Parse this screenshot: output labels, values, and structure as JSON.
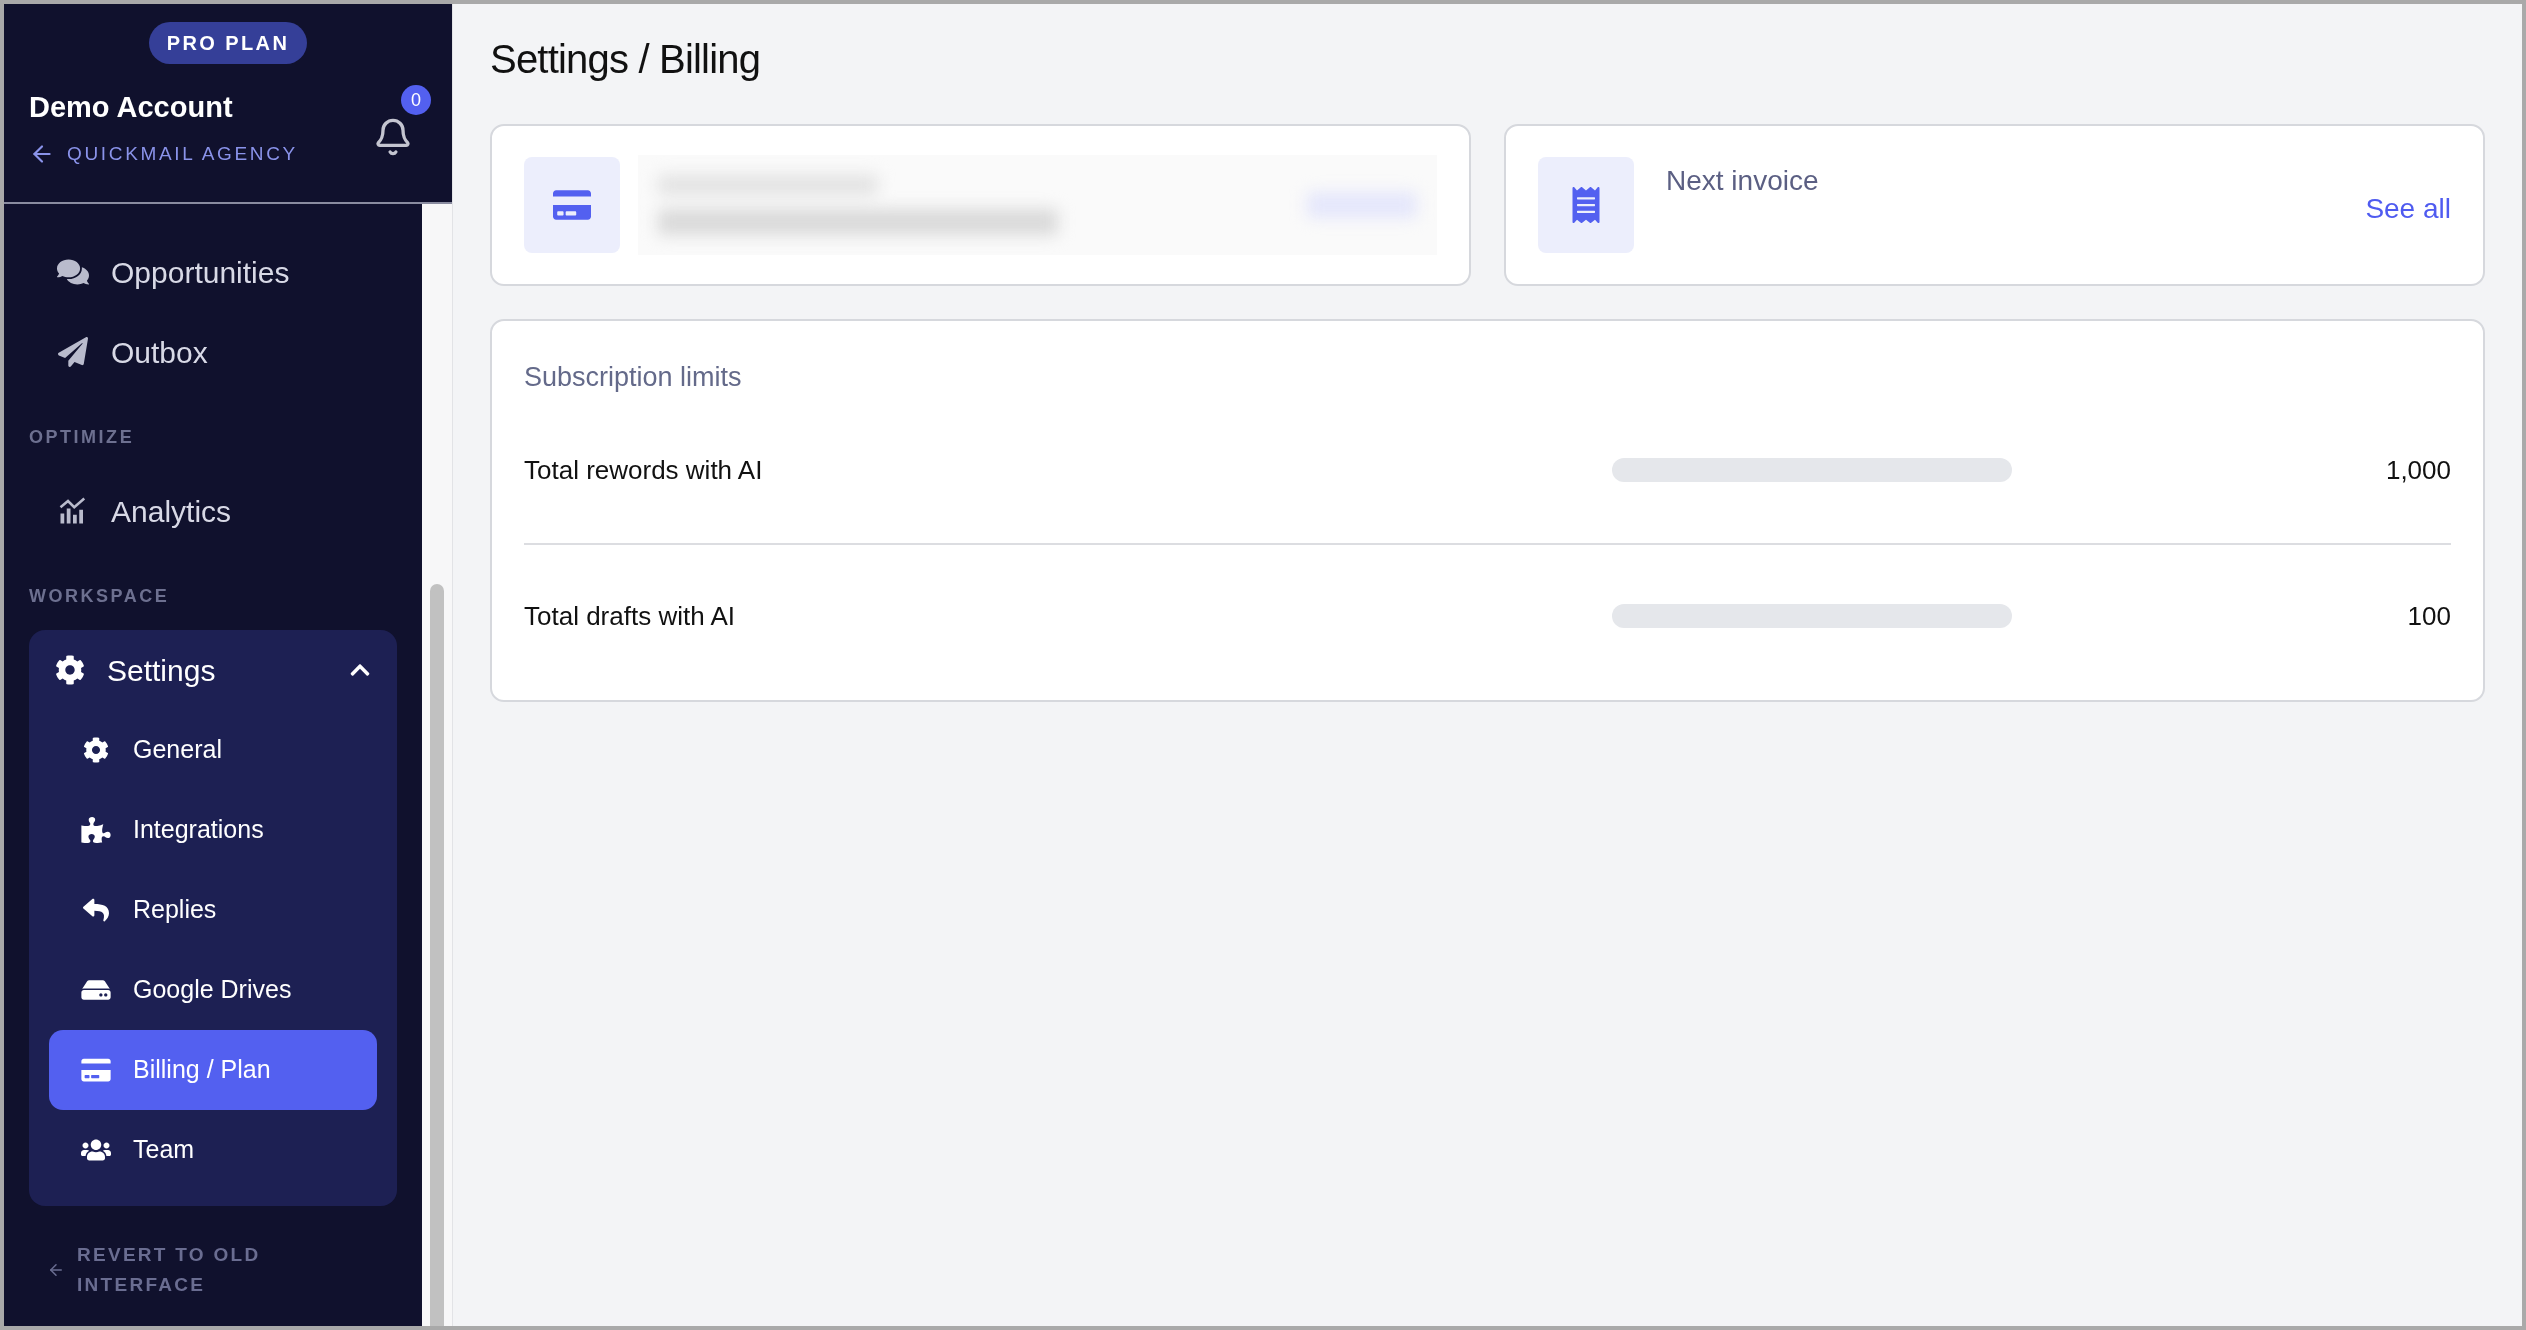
{
  "sidebar": {
    "plan_badge": "PRO PLAN",
    "account_name": "Demo Account",
    "agency_link": "QUICKMAIL AGENCY",
    "notification_count": "0",
    "sections": [
      {
        "items": [
          {
            "label": "Opportunities",
            "kind": "chat",
            "selected": false
          },
          {
            "label": "Outbox",
            "kind": "send",
            "selected": false
          }
        ]
      },
      {
        "heading": "OPTIMIZE",
        "items": [
          {
            "label": "Analytics",
            "kind": "chart",
            "selected": false
          }
        ]
      },
      {
        "heading": "WORKSPACE",
        "items": [
          {
            "label": "Settings",
            "kind": "gear",
            "selected": false,
            "expanded": true,
            "children": [
              {
                "label": "General",
                "kind": "gear",
                "selected": false
              },
              {
                "label": "Integrations",
                "kind": "puzzle",
                "selected": false
              },
              {
                "label": "Replies",
                "kind": "reply",
                "selected": false
              },
              {
                "label": "Google Drives",
                "kind": "drive",
                "selected": false
              },
              {
                "label": "Billing / Plan",
                "kind": "card",
                "selected": true
              },
              {
                "label": "Team",
                "kind": "users",
                "selected": false
              }
            ]
          }
        ]
      }
    ],
    "revert_link": "REVERT TO OLD INTERFACE"
  },
  "page_title": "Settings / Billing",
  "invoice_card": {
    "title": "Next invoice",
    "link": "See all"
  },
  "subscription_limits": {
    "title": "Subscription limits",
    "rows": [
      {
        "label": "Total rewords with AI",
        "level": 0,
        "limit": "1,000"
      },
      {
        "label": "Total drafts with AI",
        "level": 0,
        "limit": "100"
      }
    ]
  }
}
